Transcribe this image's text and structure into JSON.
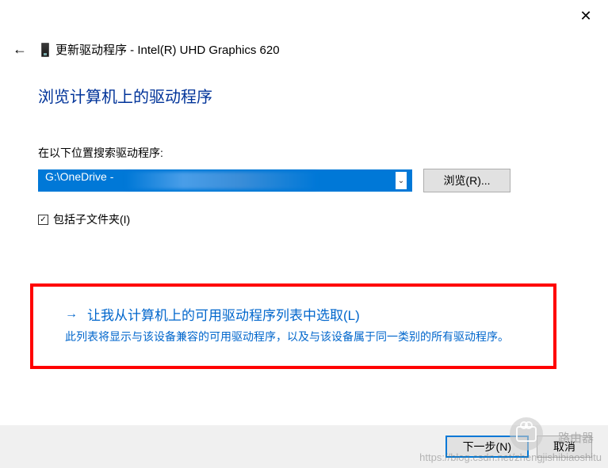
{
  "window": {
    "title_prefix": "更新驱动程序 - ",
    "device_name": "Intel(R) UHD Graphics 620"
  },
  "heading": "浏览计算机上的驱动程序",
  "search": {
    "label": "在以下位置搜索驱动程序:",
    "path_value": "G:\\OneDrive -",
    "browse_label": "浏览(R)..."
  },
  "checkbox": {
    "checked": true,
    "label": "包括子文件夹(I)"
  },
  "option": {
    "title": "让我从计算机上的可用驱动程序列表中选取(L)",
    "description": "此列表将显示与该设备兼容的可用驱动程序，以及与该设备属于同一类别的所有驱动程序。"
  },
  "footer": {
    "next_label": "下一步(N)",
    "cancel_label": "取消"
  },
  "watermark": {
    "brand": "路由器",
    "url": "https://blog.csdn.net/zhengjishibiaoshitu"
  }
}
